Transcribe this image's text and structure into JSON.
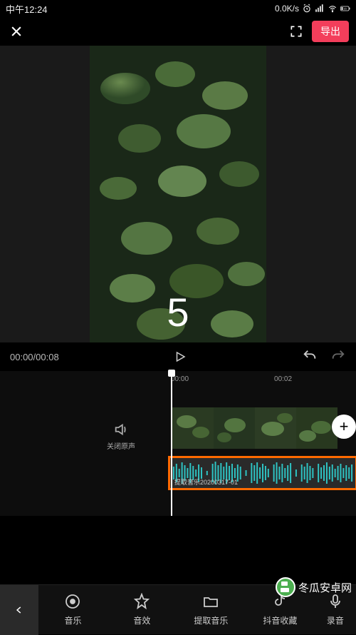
{
  "status_bar": {
    "time": "中午12:24",
    "net_speed": "0.0K/s",
    "battery": "15"
  },
  "top_bar": {
    "export_label": "导出"
  },
  "preview": {
    "countdown": "5"
  },
  "controls": {
    "current_time": "00:00",
    "total_time": "00:08"
  },
  "timeline": {
    "ruler": [
      "00:00",
      "00:02"
    ],
    "mute_label": "关闭原声",
    "audio_clip_label": "提取音乐20200317-01",
    "add_label": "+"
  },
  "toolbar": {
    "items": [
      {
        "label": "音乐"
      },
      {
        "label": "音效"
      },
      {
        "label": "提取音乐"
      },
      {
        "label": "抖音收藏"
      },
      {
        "label": "录音"
      }
    ]
  },
  "watermark": "冬瓜安卓网"
}
